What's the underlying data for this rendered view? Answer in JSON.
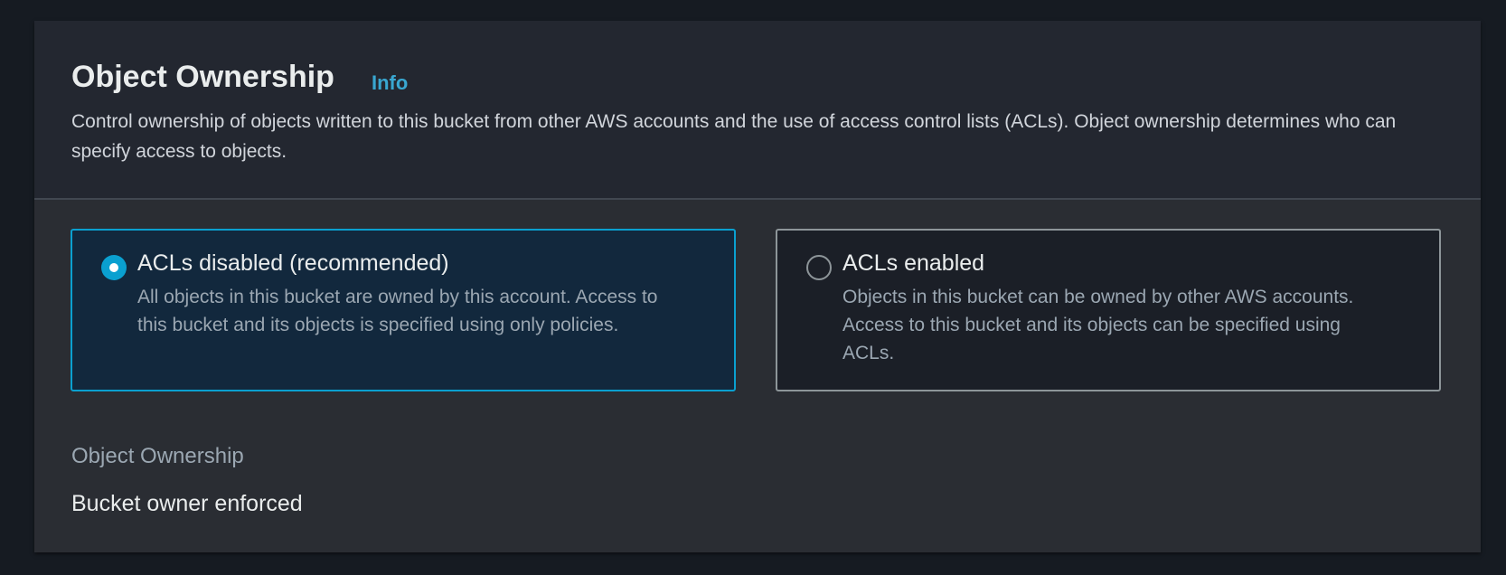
{
  "section": {
    "title": "Object Ownership",
    "info_link": "Info",
    "description": "Control ownership of objects written to this bucket from other AWS accounts and the use of access control lists (ACLs). Object ownership determines who can specify access to objects."
  },
  "options": [
    {
      "label": "ACLs disabled (recommended)",
      "description": "All objects in this bucket are owned by this account. Access to this bucket and its objects is specified using only policies.",
      "selected": true
    },
    {
      "label": "ACLs enabled",
      "description": "Objects in this bucket can be owned by other AWS accounts. Access to this bucket and its objects can be specified using ACLs.",
      "selected": false
    }
  ],
  "field": {
    "label": "Object Ownership",
    "value": "Bucket owner enforced"
  },
  "colors": {
    "accent": "#0aa0d0",
    "link": "#39a7d1",
    "panel": "#2a2d33"
  }
}
